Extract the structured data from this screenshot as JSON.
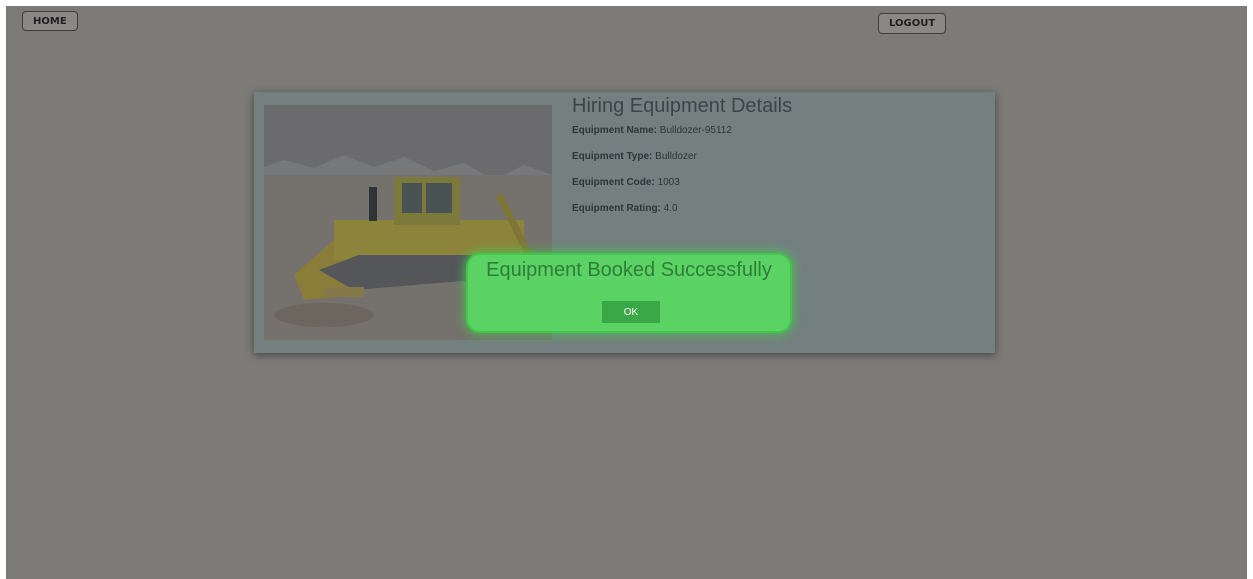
{
  "nav": {
    "home_label": "HOME",
    "logout_label": "LOGOUT"
  },
  "card": {
    "title": "Hiring Equipment Details",
    "fields": [
      {
        "label": "Equipment Name:",
        "value": "Bulldozer-95112"
      },
      {
        "label": "Equipment Type:",
        "value": "Bulldozer"
      },
      {
        "label": "Equipment Code:",
        "value": "1003"
      },
      {
        "label": "Equipment Rating:",
        "value": "4.0"
      }
    ]
  },
  "dialog": {
    "message": "Equipment Booked Successfully",
    "ok_label": "OK"
  },
  "colors": {
    "overlay": "#7d7b78",
    "card": "#747f80",
    "dialog": "#5bd364",
    "ok_button": "#3ba848"
  },
  "icons": {
    "photo": "bulldozer-photo"
  }
}
